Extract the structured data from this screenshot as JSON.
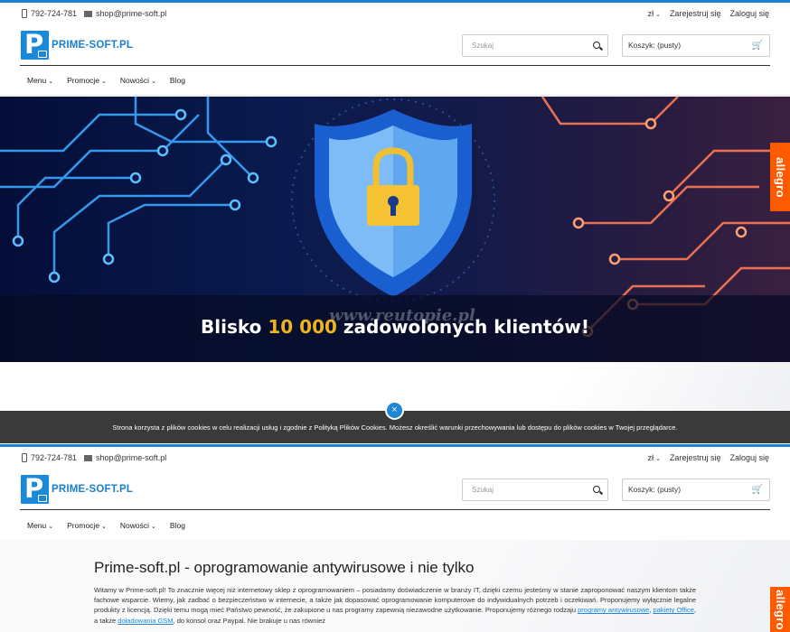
{
  "topbar": {
    "phone": "792-724-781",
    "email": "shop@prime-soft.pl",
    "currency": "zł",
    "register": "Zarejestruj się",
    "login": "Zaloguj się"
  },
  "brand": {
    "logo_letter": "P",
    "name": "PRIME-SOFT.PL",
    "color": "#1a8ad8"
  },
  "search": {
    "placeholder": "Szukaj"
  },
  "cart": {
    "label": "Koszyk:",
    "status": "(pusty)"
  },
  "nav": {
    "items": [
      "Menu",
      "Promocje",
      "Nowości",
      "Blog"
    ]
  },
  "hero": {
    "caption_before": "Blisko ",
    "caption_highlight": "10 000",
    "caption_after": " zadowolonych klientów!",
    "watermark": "www.reutopie.pl",
    "highlight_color": "#f0b320"
  },
  "allegro": {
    "label": "allegro",
    "color": "#ff5a00"
  },
  "cookie": {
    "text": "Strona korzysta z plików cookies w celu realizacji usług i zgodnie z Polityką Plików Cookies. Możesz określić warunki przechowywania lub dostępu do plików cookies w Twojej przeglądarce.",
    "close_icon": "×"
  },
  "content": {
    "title": "Prime-soft.pl - oprogramowanie antywirusowe i nie tylko",
    "intro": "Witamy w Prime-soft.pl! To znacznie więcej niż internetowy sklep z oprogramowaniem – posiadamy doświadczenie w branży IT, dzięki czemu jesteśmy w stanie zaproponować naszym klientom także fachowe wsparcie. Wiemy, jak zadbać o bezpieczeństwo w internecie, a także jak dopasować oprogramowanie komputerowe do indywidualnych potrzeb i oczekiwań. Proponujemy wyłącznie legalne produkty z licencją. Dzięki temu mogą mieć Państwo pewność, że zakupione u nas programy zapewnią niezawodne użytkowanie. Proponujemy różnego rodzaju ",
    "link1": "programy antywirusowe",
    "sep1": ", ",
    "link2": "pakiety Office",
    "sep2": ", a także ",
    "link3": "doładowania GSM",
    "tail": ", do konsol oraz Paypal. Nie brakuje u nas również"
  }
}
